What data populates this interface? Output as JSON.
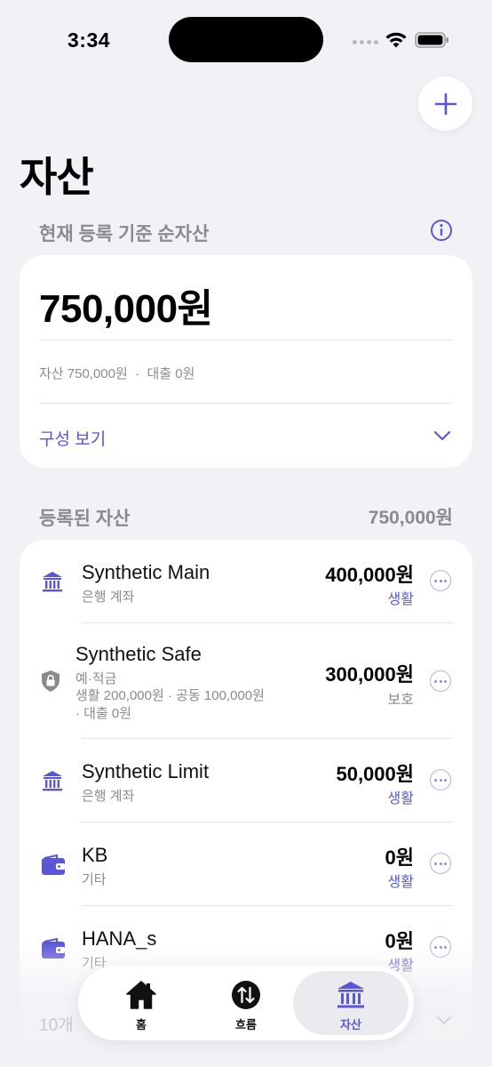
{
  "status_bar": {
    "time": "3:34"
  },
  "header": {
    "title": "자산"
  },
  "net_worth": {
    "label": "현재 등록 기준 순자산",
    "amount": "750,000원",
    "breakdown": "자산 750,000원  ·  대출 0원",
    "compose_link": "구성 보기"
  },
  "registered": {
    "label": "등록된 자산",
    "total": "750,000원",
    "items": [
      {
        "name": "Synthetic Main",
        "type": "은행 계좌",
        "amount": "400,000원",
        "tag": "생활",
        "icon": "bank-icon"
      },
      {
        "name": "Synthetic Safe",
        "type": "예·적금",
        "sub_line1": "생활 200,000원 · 공동 100,000원",
        "sub_line2": "· 대출 0원",
        "amount": "300,000원",
        "tag": "보호",
        "icon": "lock-shield-icon"
      },
      {
        "name": "Synthetic Limit",
        "type": "은행 계좌",
        "amount": "50,000원",
        "tag": "생활",
        "icon": "bank-icon"
      },
      {
        "name": "KB",
        "type": "기타",
        "amount": "0원",
        "tag": "생활",
        "icon": "wallet-icon"
      },
      {
        "name": "HANA_s",
        "type": "기타",
        "amount": "0원",
        "tag": "생활",
        "icon": "wallet-icon"
      }
    ],
    "collapsed_count": "10개"
  },
  "tab_bar": {
    "tabs": [
      {
        "label": "홈",
        "icon": "home-icon",
        "active": false
      },
      {
        "label": "흐름",
        "icon": "flow-icon",
        "active": false
      },
      {
        "label": "자산",
        "icon": "bank-icon",
        "active": true
      }
    ]
  },
  "colors": {
    "accent": "#5a57d6",
    "background": "#f2f2f6",
    "card": "#ffffff",
    "muted": "#8a8a8f"
  }
}
